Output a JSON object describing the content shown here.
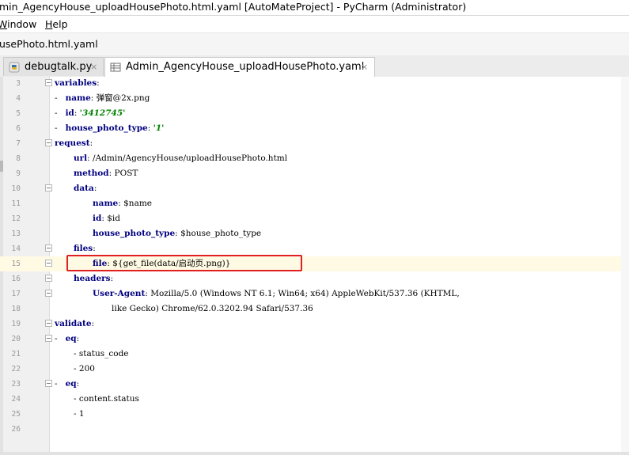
{
  "window": {
    "title": "min_AgencyHouse_uploadHousePhoto.html.yaml [AutoMateProject] - PyCharm (Administrator)"
  },
  "menu": {
    "items": [
      {
        "label": "Window",
        "mnemonic": "W"
      },
      {
        "label": "Help",
        "mnemonic": "H"
      }
    ]
  },
  "navbar": {
    "breadcrumb": "usePhoto.html.yaml"
  },
  "tabs": [
    {
      "label": "debugtalk.py",
      "icon": "python-file-icon",
      "active": false
    },
    {
      "label": "Admin_AgencyHouse_uploadHousePhoto.yaml",
      "icon": "yaml-file-icon",
      "active": true
    }
  ],
  "tab_close_glyph": "×",
  "editor": {
    "current_line": "15",
    "lines": [
      {
        "n": "3",
        "indent": 0,
        "key": "variables",
        "sep": ":",
        "val": ""
      },
      {
        "n": "4",
        "indent": 0,
        "key": "",
        "sep": "",
        "val": "-   name: 弹窗@2x.png"
      },
      {
        "n": "5",
        "indent": 0,
        "key": "",
        "sep": "",
        "val": "-   id: '3412745'"
      },
      {
        "n": "6",
        "indent": 0,
        "key": "",
        "sep": "",
        "val": "-   house_photo_type: '1'"
      },
      {
        "n": "7",
        "indent": 0,
        "key": "request",
        "sep": ":",
        "val": ""
      },
      {
        "n": "8",
        "indent": 2,
        "key": "url",
        "sep": ": ",
        "val": "/Admin/AgencyHouse/uploadHousePhoto.html"
      },
      {
        "n": "9",
        "indent": 2,
        "key": "method",
        "sep": ": ",
        "val": "POST"
      },
      {
        "n": "10",
        "indent": 2,
        "key": "data",
        "sep": ":",
        "val": ""
      },
      {
        "n": "11",
        "indent": 4,
        "key": "name",
        "sep": ": ",
        "val": "$name"
      },
      {
        "n": "12",
        "indent": 4,
        "key": "id",
        "sep": ": ",
        "val": "$id"
      },
      {
        "n": "13",
        "indent": 4,
        "key": "house_photo_type",
        "sep": ": ",
        "val": "$house_photo_type"
      },
      {
        "n": "14",
        "indent": 2,
        "key": "files",
        "sep": ":",
        "val": ""
      },
      {
        "n": "15",
        "indent": 4,
        "key": "file",
        "sep": ": ",
        "val": "${get_file(data/启动页.png)}"
      },
      {
        "n": "16",
        "indent": 2,
        "key": "headers",
        "sep": ":",
        "val": ""
      },
      {
        "n": "17",
        "indent": 4,
        "key": "User-Agent",
        "sep": ": ",
        "val": "Mozilla/5.0 (Windows NT 6.1; Win64; x64) AppleWebKit/537.36 (KHTML,"
      },
      {
        "n": "18",
        "indent": 6,
        "key": "",
        "sep": "",
        "val": "like Gecko) Chrome/62.0.3202.94 Safari/537.36"
      },
      {
        "n": "19",
        "indent": 0,
        "key": "validate",
        "sep": ":",
        "val": ""
      },
      {
        "n": "20",
        "indent": 0,
        "key": "",
        "sep": "",
        "val": "-   eq:"
      },
      {
        "n": "21",
        "indent": 2,
        "key": "",
        "sep": "",
        "val": "- status_code"
      },
      {
        "n": "22",
        "indent": 2,
        "key": "",
        "sep": "",
        "val": "- 200"
      },
      {
        "n": "23",
        "indent": 0,
        "key": "",
        "sep": "",
        "val": "-   eq:"
      },
      {
        "n": "24",
        "indent": 2,
        "key": "",
        "sep": "",
        "val": "- content.status"
      },
      {
        "n": "25",
        "indent": 2,
        "key": "",
        "sep": "",
        "val": "- 1"
      },
      {
        "n": "26",
        "indent": 0,
        "key": "",
        "sep": "",
        "val": ""
      }
    ]
  },
  "colors": {
    "keyword": "#000080",
    "string": "#008000",
    "current_line_bg": "#fffae3",
    "annotation_box": "#e02020"
  }
}
